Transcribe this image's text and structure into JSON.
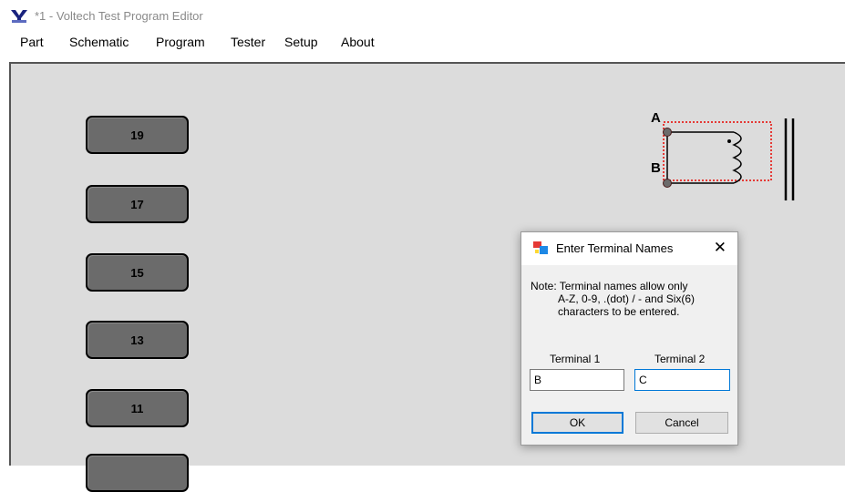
{
  "window": {
    "title": "*1 - Voltech Test Program Editor"
  },
  "menu": [
    {
      "label": "Part"
    },
    {
      "label": "Schematic"
    },
    {
      "label": "Program"
    },
    {
      "label": "Tester"
    },
    {
      "label": "Setup"
    },
    {
      "label": "About"
    }
  ],
  "pins": [
    {
      "label": "19"
    },
    {
      "label": "17"
    },
    {
      "label": "15"
    },
    {
      "label": "13"
    },
    {
      "label": "11"
    }
  ],
  "schematic": {
    "terminal_a": "A",
    "terminal_b": "B"
  },
  "dialog": {
    "title": "Enter Terminal Names",
    "close": "✕",
    "note_line1": "Note: Terminal names allow only",
    "note_line2": "A-Z, 0-9, .(dot) / - and Six(6)",
    "note_line3": "characters to be entered.",
    "terminal1_label": "Terminal 1",
    "terminal2_label": "Terminal 2",
    "terminal1_value": "B",
    "terminal2_value": "C",
    "ok": "OK",
    "cancel": "Cancel"
  }
}
